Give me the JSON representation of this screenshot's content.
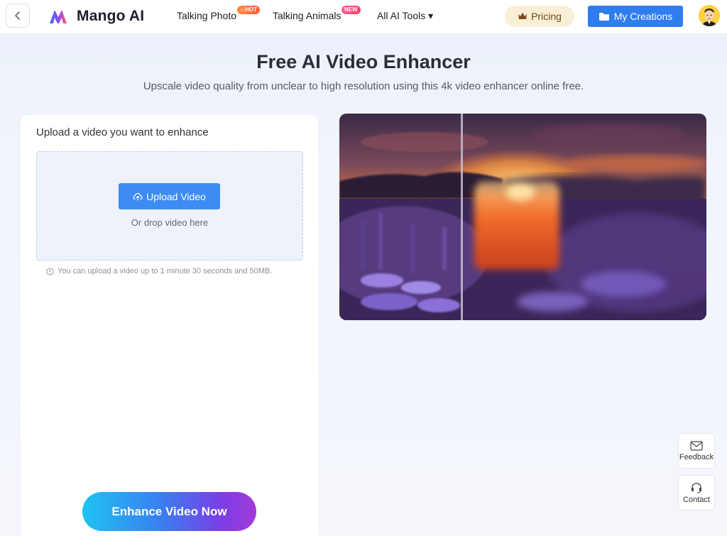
{
  "header": {
    "logo_text": "Mango AI",
    "nav": [
      {
        "label": "Talking Photo",
        "badge": "HOT"
      },
      {
        "label": "Talking Animals",
        "badge": "NEW"
      },
      {
        "label": "All AI Tools ▾"
      }
    ],
    "pricing_label": "Pricing",
    "creations_label": "My Creations",
    "icons": {
      "back": "chevron-left-icon",
      "pricing": "crown-icon",
      "creations": "folder-icon",
      "avatar": "user-avatar"
    }
  },
  "hero": {
    "title": "Free AI Video Enhancer",
    "subtitle": "Upscale video quality from unclear to high resolution using this 4k video enhancer online free."
  },
  "upload_panel": {
    "heading": "Upload a video you want to enhance",
    "upload_button": "Upload Video",
    "drop_text": "Or drop video here",
    "limit_note": "You can upload a video up to 1 minute 30 seconds and 50MB.",
    "enhance_button": "Enhance Video Now"
  },
  "side_buttons": {
    "feedback": "Feedback",
    "contact": "Contact"
  },
  "colors": {
    "primary": "#2f7df0",
    "upload_button": "#3d8cf4",
    "pricing_bg": "#fbeed6",
    "enhance_gradient_start": "#1fc3f2",
    "enhance_gradient_end": "#a53ad8"
  }
}
